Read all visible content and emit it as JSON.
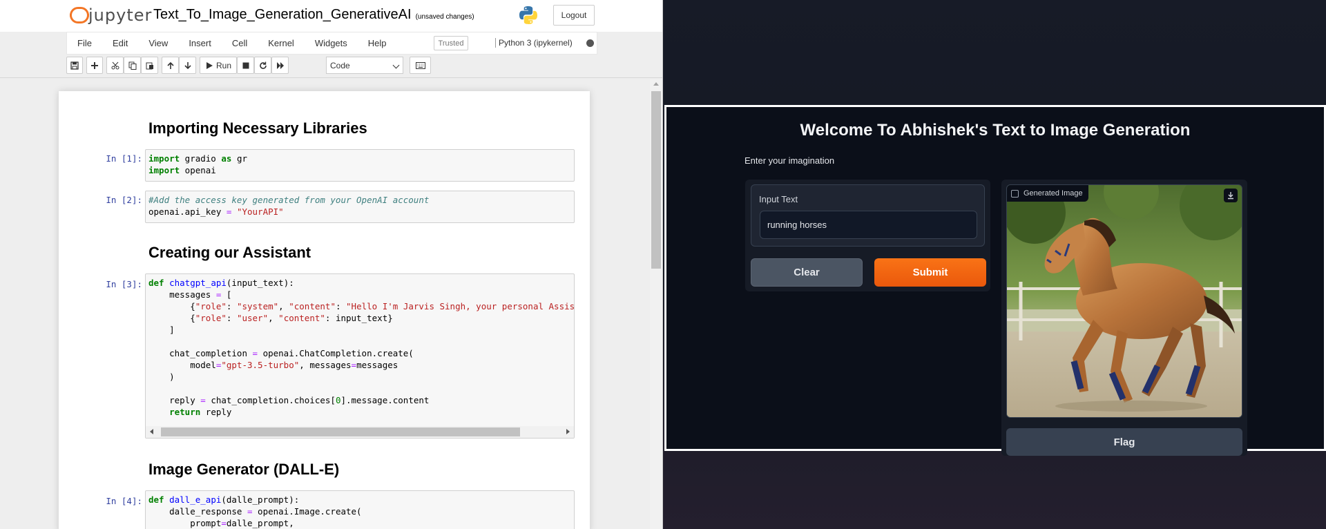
{
  "jupyter": {
    "logo_text": "jupyter",
    "notebook_title": "Text_To_Image_Generation_GenerativeAI",
    "save_status": "(unsaved changes)",
    "logout_label": "Logout",
    "menu": [
      "File",
      "Edit",
      "View",
      "Insert",
      "Cell",
      "Kernel",
      "Widgets",
      "Help"
    ],
    "trusted_label": "Trusted",
    "kernel_name": "Python 3 (ipykernel)",
    "run_label": "Run",
    "cell_type": "Code",
    "headings": [
      "Importing Necessary Libraries",
      "Creating our Assistant",
      "Image Generator (DALL-E)"
    ],
    "prompts": [
      "In [1]:",
      "In [2]:",
      "In [3]:",
      "In [4]:"
    ]
  },
  "gradio": {
    "title": "Welcome To Abhishek's Text to Image Generation",
    "description": "Enter your imagination",
    "input_label": "Input Text",
    "input_value": "running horses",
    "clear_label": "Clear",
    "submit_label": "Submit",
    "image_label": "Generated Image",
    "flag_label": "Flag"
  },
  "colors": {
    "accent": "#f97316",
    "bg_dark": "#0b0f19",
    "prompt_blue": "#303f9f"
  },
  "icons": [
    "jupyter-logo",
    "python-logo",
    "save-icon",
    "plus-icon",
    "cut-icon",
    "copy-icon",
    "paste-icon",
    "arrow-up-icon",
    "arrow-down-icon",
    "run-icon",
    "stop-icon",
    "restart-icon",
    "fast-forward-icon",
    "keyboard-icon",
    "image-icon",
    "download-icon"
  ]
}
